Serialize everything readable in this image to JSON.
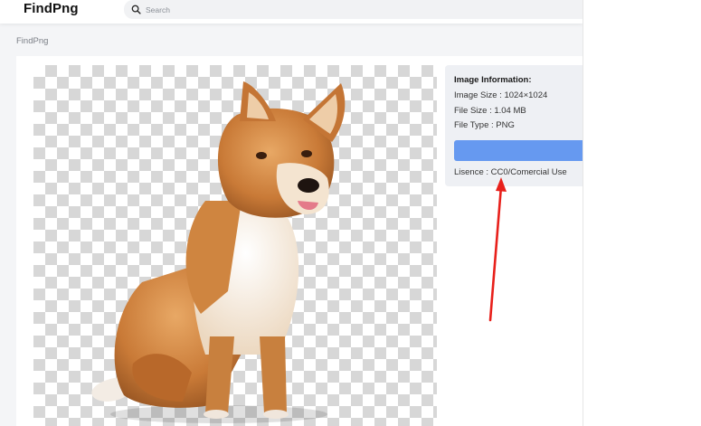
{
  "header": {
    "logo": "FindPng",
    "search": {
      "placeholder": "Search",
      "value": ""
    }
  },
  "breadcrumb": "FindPng",
  "image": {
    "subject": "dog-illustration",
    "alt": "",
    "checker_colors": [
      "#ffffff",
      "#d7d7d7"
    ]
  },
  "info": {
    "title": "Image Information:",
    "image_size": "Image Size : 1024×1024",
    "file_size": "File Size : 1.04 MB",
    "file_type": "File Type : PNG",
    "download_label": "",
    "license": "Lisence : CC0/Comercial Use"
  },
  "annotation": {
    "icon": "red-arrow",
    "color": "#e8201b"
  },
  "colors": {
    "accent_button": "#6699f0",
    "panel_bg": "#eef0f4",
    "page_bg": "#f4f5f7"
  }
}
